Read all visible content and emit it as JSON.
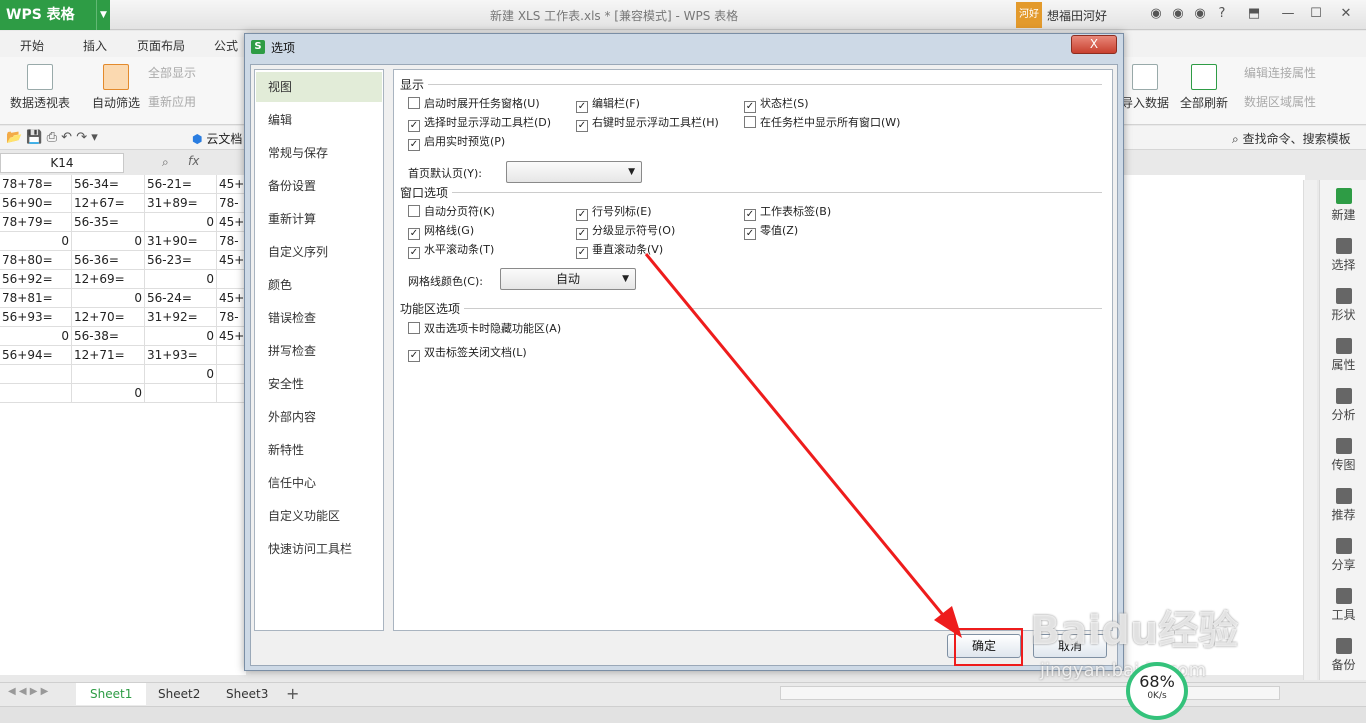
{
  "app": {
    "menu_label": "WPS 表格",
    "doc_title": "新建 XLS 工作表.xls * [兼容模式] - WPS 表格",
    "user_badge": "河好",
    "user_name": "想福田河好"
  },
  "tabs": [
    "开始",
    "插入",
    "页面布局",
    "公式"
  ],
  "ribbon": {
    "pivot": "数据透视表",
    "autofilter": "自动筛选",
    "show_all": "全部显示",
    "reapply": "重新应用",
    "import": "导入数据",
    "refresh_all": "全部刷新",
    "edit_links": "编辑连接属性",
    "data_range": "数据区域属性",
    "search": "查找命令、搜索模板",
    "cloud_doc": "云文档"
  },
  "formula": {
    "cell_ref": "K14",
    "fx": "fx"
  },
  "grid": [
    [
      "78+78=",
      "56-34=",
      "56-21=",
      "45+"
    ],
    [
      "56+90=",
      "12+67=",
      "31+89=",
      "78-"
    ],
    [
      "78+79=",
      "56-35=",
      "0",
      "45+"
    ],
    [
      "0",
      "0",
      "31+90=",
      "78-"
    ],
    [
      "78+80=",
      "56-36=",
      "56-23=",
      "45+"
    ],
    [
      "56+92=",
      "12+69=",
      "0",
      ""
    ],
    [
      "78+81=",
      "0",
      "56-24=",
      "45+"
    ],
    [
      "56+93=",
      "12+70=",
      "31+92=",
      "78-"
    ],
    [
      "0",
      "56-38=",
      "0",
      "45+"
    ],
    [
      "56+94=",
      "12+71=",
      "31+93=",
      ""
    ],
    [
      "",
      "",
      "0",
      ""
    ],
    [
      "",
      "0",
      "",
      ""
    ]
  ],
  "sheets": [
    "Sheet1",
    "Sheet2",
    "Sheet3"
  ],
  "sheet_add": "+",
  "right_panel": [
    "新建",
    "选择",
    "形状",
    "属性",
    "分析",
    "传图",
    "推荐",
    "分享",
    "工具",
    "备份"
  ],
  "dialog": {
    "title": "选项",
    "close": "X",
    "nav": [
      "视图",
      "编辑",
      "常规与保存",
      "备份设置",
      "重新计算",
      "自定义序列",
      "颜色",
      "错误检查",
      "拼写检查",
      "安全性",
      "外部内容",
      "新特性",
      "信任中心",
      "自定义功能区",
      "快速访问工具栏"
    ],
    "sections": {
      "display": "显示",
      "window": "窗口选项",
      "ribbon": "功能区选项"
    },
    "display_opts": [
      {
        "label": "启动时展开任务窗格(U)",
        "checked": false
      },
      {
        "label": "编辑栏(F)",
        "checked": true
      },
      {
        "label": "状态栏(S)",
        "checked": true
      },
      {
        "label": "选择时显示浮动工具栏(D)",
        "checked": true
      },
      {
        "label": "右键时显示浮动工具栏(H)",
        "checked": true
      },
      {
        "label": "在任务栏中显示所有窗口(W)",
        "checked": false
      },
      {
        "label": "启用实时预览(P)",
        "checked": true
      }
    ],
    "homepage_label": "首页默认页(Y):",
    "homepage_value": "",
    "window_opts": [
      {
        "label": "自动分页符(K)",
        "checked": false
      },
      {
        "label": "行号列标(E)",
        "checked": true
      },
      {
        "label": "工作表标签(B)",
        "checked": true
      },
      {
        "label": "网格线(G)",
        "checked": true
      },
      {
        "label": "分级显示符号(O)",
        "checked": true
      },
      {
        "label": "零值(Z)",
        "checked": true
      },
      {
        "label": "水平滚动条(T)",
        "checked": true
      },
      {
        "label": "垂直滚动条(V)",
        "checked": true
      }
    ],
    "gridcolor_label": "网格线颜色(C):",
    "gridcolor_value": "自动",
    "ribbon_opts": [
      {
        "label": "双击选项卡时隐藏功能区(A)",
        "checked": false
      },
      {
        "label": "双击标签关闭文档(L)",
        "checked": true
      }
    ],
    "ok": "确定",
    "cancel": "取消"
  },
  "overlay": {
    "watermark": "Baidu经验",
    "watermark_url": "jingyan.baidu.com",
    "speed_pct": "68%",
    "speed_rate": "0K/s"
  },
  "colors": {
    "wps_green": "#2e9c45",
    "annotation_red": "#ee1c1c"
  }
}
